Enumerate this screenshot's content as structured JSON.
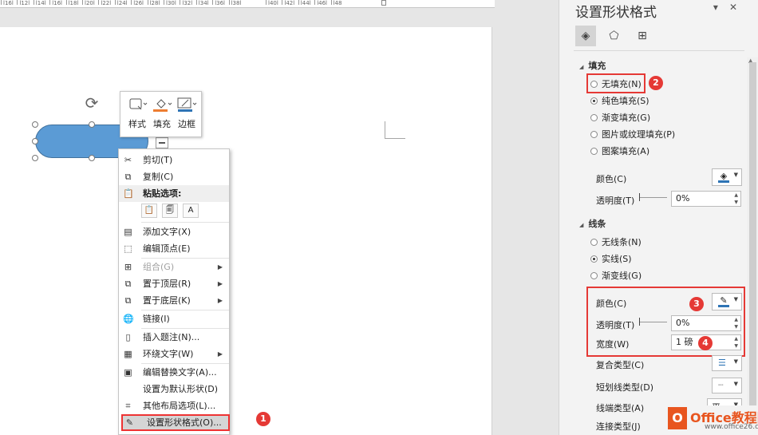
{
  "ruler": {
    "ticks": [
      "l16l",
      "l12l",
      "l14l",
      "l16l",
      "l18l",
      "l20l",
      "l22l",
      "l24l",
      "l26l",
      "l28l",
      "l30l",
      "l32l",
      "l34l",
      "l36l",
      "l38l",
      "l40l",
      "l42l",
      "l44l",
      "l46l",
      "l48"
    ]
  },
  "mini_toolbar": {
    "style_label": "样式",
    "fill_label": "填充",
    "border_label": "边框",
    "fill_color": "#ed7d31",
    "border_color": "#2e74b5"
  },
  "shape": {
    "fill_color": "#5b9bd5"
  },
  "context_menu": {
    "cut": "剪切(T)",
    "copy": "复制(C)",
    "paste_options": "粘贴选项:",
    "paste_icons": [
      "📋",
      "🗐",
      "A"
    ],
    "add_text": "添加文字(X)",
    "edit_points": "编辑顶点(E)",
    "group": "组合(G)",
    "bring_to_front": "置于顶层(R)",
    "send_to_back": "置于底层(K)",
    "link": "链接(I)",
    "insert_caption": "插入题注(N)...",
    "wrap_text": "环绕文字(W)",
    "edit_alt_text": "编辑替换文字(A)...",
    "set_default_shape": "设置为默认形状(D)",
    "more_layout": "其他布局选项(L)...",
    "format_shape": "设置形状格式(O)..."
  },
  "badges": {
    "b1": "1",
    "b2": "2",
    "b3": "3",
    "b4": "4"
  },
  "pane": {
    "title": "设置形状格式",
    "fill_section": "填充",
    "fill_options": [
      "无填充(N)",
      "纯色填充(S)",
      "渐变填充(G)",
      "图片或纹理填充(P)",
      "图案填充(A)"
    ],
    "fill_selected": "纯色填充(S)",
    "fill_color_label": "颜色(C)",
    "fill_transparency_label": "透明度(T)",
    "fill_transparency_value": "0%",
    "line_section": "线条",
    "line_options": [
      "无线条(N)",
      "实线(S)",
      "渐变线(G)"
    ],
    "line_selected": "实线(S)",
    "line_color_label": "颜色(C)",
    "line_transparency_label": "透明度(T)",
    "line_transparency_value": "0%",
    "width_label": "宽度(W)",
    "width_value": "1 磅",
    "compound_label": "复合类型(C)",
    "dash_label": "短划线类型(D)",
    "cap_label": "线端类型(A)",
    "cap_value": "平",
    "join_label": "连接类型(J)"
  },
  "logo": {
    "mark": "O",
    "name": "Office教程网",
    "url": "www.office26.com"
  }
}
